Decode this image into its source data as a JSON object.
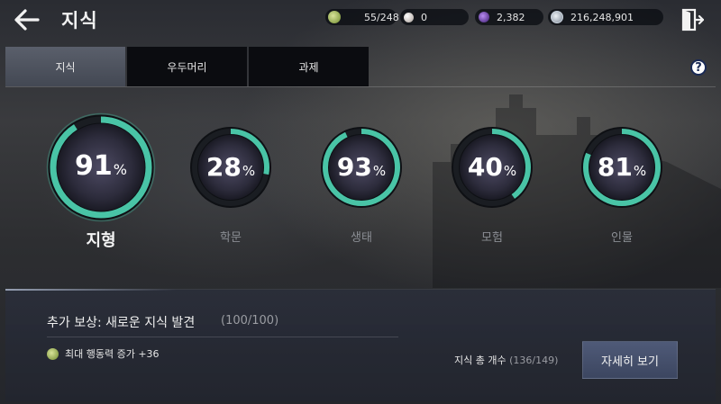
{
  "header": {
    "title": "지식",
    "currencies": [
      {
        "icon": "action-power-icon",
        "value": "55/248",
        "color": "#9fb85a"
      },
      {
        "icon": "pearl-icon",
        "value": "0",
        "color": "#d9d4d0"
      },
      {
        "icon": "dark-crystal-icon",
        "value": "2,382",
        "color": "#6a3ca8"
      },
      {
        "icon": "silver-coin-icon",
        "value": "216,248,901",
        "color": "#b9c3cf"
      }
    ]
  },
  "tabs": [
    {
      "label": "지식",
      "active": true
    },
    {
      "label": "우두머리",
      "active": false
    },
    {
      "label": "과제",
      "active": false
    }
  ],
  "help": {
    "label": "?"
  },
  "categories": [
    {
      "name": "지형",
      "percent": 91,
      "active": true
    },
    {
      "name": "학문",
      "percent": 28,
      "active": false
    },
    {
      "name": "생태",
      "percent": 93,
      "active": false
    },
    {
      "name": "모험",
      "percent": 40,
      "active": false
    },
    {
      "name": "인물",
      "percent": 81,
      "active": false
    }
  ],
  "percent_sign": "%",
  "reward": {
    "title": "추가 보상: 새로운 지식 발견",
    "count": "(100/100)",
    "item_text": "최대 행동력 증가 +36"
  },
  "total": {
    "label": "지식 총 개수",
    "count": "(136/149)"
  },
  "detail_button": "자세히 보기",
  "colors": {
    "gauge_fill": "#49c4a6",
    "gauge_track": "#1a1d22"
  }
}
